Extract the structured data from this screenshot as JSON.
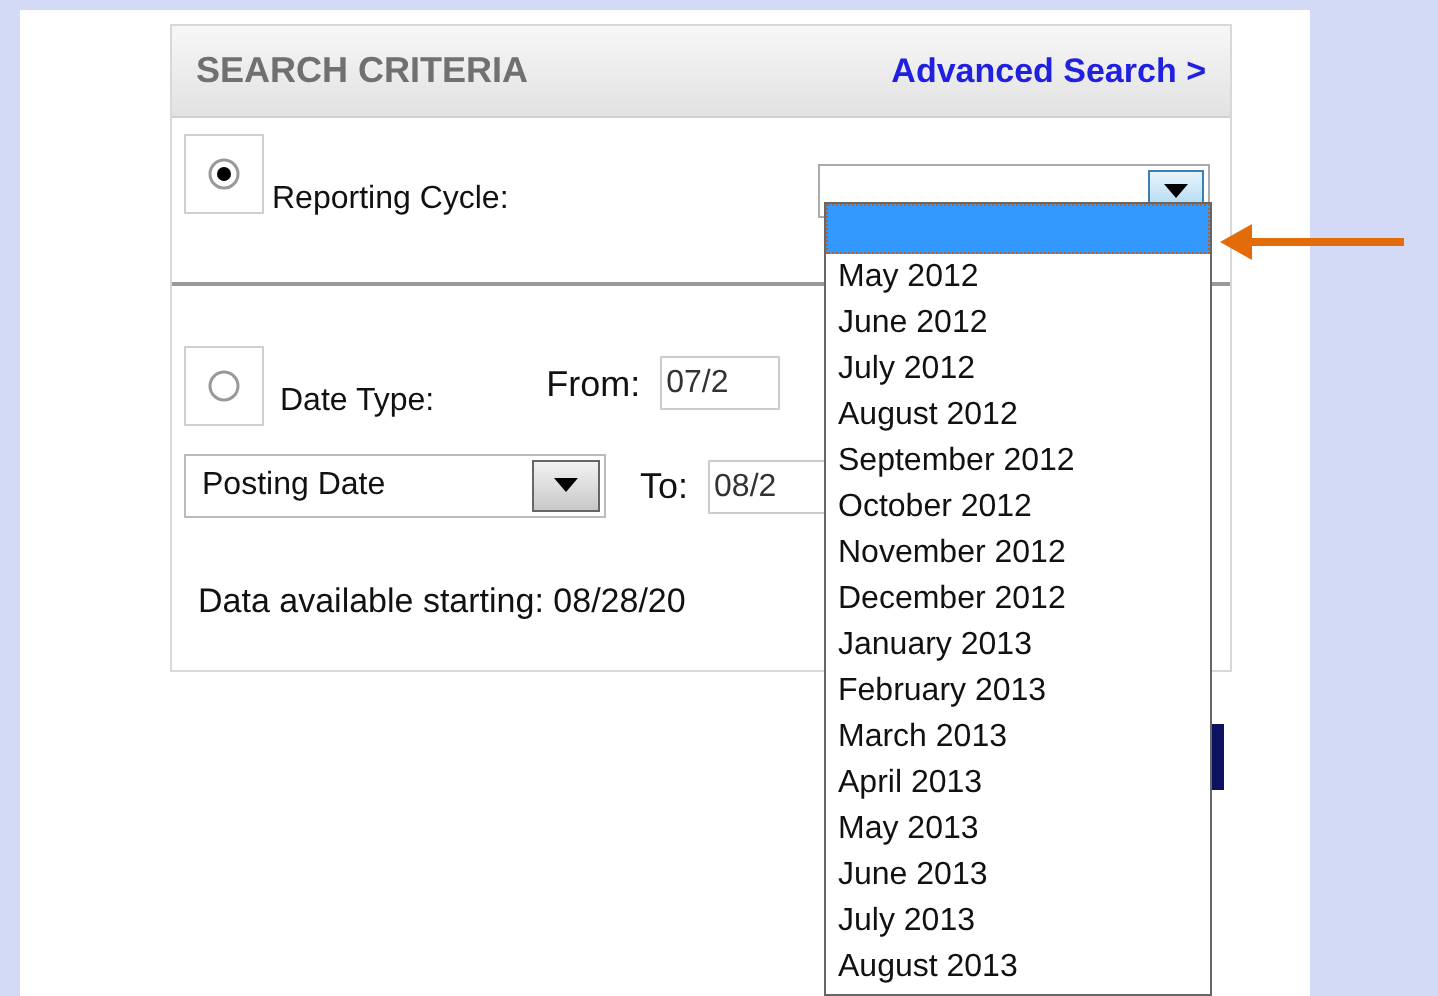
{
  "header": {
    "title": "SEARCH CRITERIA",
    "link": "Advanced Search >"
  },
  "reporting_cycle": {
    "selected": true,
    "label": "Reporting Cycle:",
    "dropdown": {
      "expanded": true,
      "options": [
        {
          "selected": true
        },
        {
          "label": "May 2012",
          "selected": false
        },
        {
          "label": "June 2012",
          "selected": false
        },
        {
          "label": "July 2012",
          "selected": false
        },
        {
          "label": "August 2012",
          "selected": false
        },
        {
          "label": "September 2012",
          "selected": false
        },
        {
          "label": "October 2012",
          "selected": false
        },
        {
          "label": "November 2012",
          "selected": false
        },
        {
          "label": "December 2012",
          "selected": false
        },
        {
          "label": "January 2013",
          "selected": false
        },
        {
          "label": "February 2013",
          "selected": false
        },
        {
          "label": "March 2013",
          "selected": false
        },
        {
          "label": "April 2013",
          "selected": false
        },
        {
          "label": "May 2013",
          "selected": false
        },
        {
          "label": "June 2013",
          "selected": false
        },
        {
          "label": "July 2013",
          "selected": false
        },
        {
          "label": "August 2013",
          "selected": false
        }
      ]
    }
  },
  "date_type": {
    "selected": false,
    "label": "Date Type:",
    "type_select": "Posting Date",
    "from_label": "From:",
    "from_value": "07/2",
    "to_label": "To:",
    "to_value": "08/2"
  },
  "availability": "Data available starting: 08/28/20"
}
